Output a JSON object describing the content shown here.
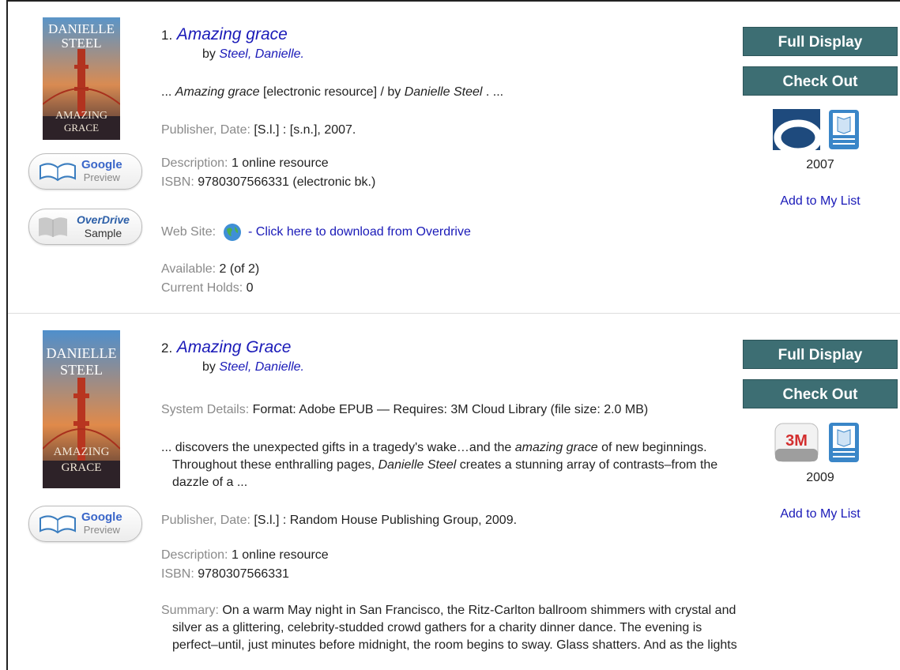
{
  "results": [
    {
      "number": "1.",
      "title": "Amazing grace",
      "by_prefix": "by",
      "author": "Steel, Danielle.",
      "snippet_pre": "... ",
      "snippet_title": "Amazing grace",
      "snippet_mid": " [electronic resource] / by ",
      "snippet_author": "Danielle Steel",
      "snippet_post": " . ...",
      "publisher_label": "Publisher, Date:",
      "publisher_value": "[S.l.] : [s.n.], 2007.",
      "description_label": "Description:",
      "description_value": "1 online resource",
      "isbn_label": "ISBN:",
      "isbn_value": "9780307566331 (electronic bk.)",
      "website_label": "Web Site:",
      "website_link": "- Click here to download from Overdrive",
      "available_label": "Available:",
      "available_value": "2 (of 2)",
      "holds_label": "Current Holds:",
      "holds_value": "0",
      "year": "2007",
      "full_display": "Full Display",
      "check_out": "Check Out",
      "add_list": "Add to My List",
      "cover_author": [
        "DANIELLE",
        "STEEL"
      ],
      "cover_title": [
        "AMAZING",
        "GRACE"
      ],
      "google_label": "Google",
      "preview_label": "Preview",
      "overdrive_label": "OverDrive",
      "sample_label": "Sample",
      "provider_icon": "overdrive-logo-icon",
      "format_icon": "ebook-icon"
    },
    {
      "number": "2.",
      "title": "Amazing Grace",
      "by_prefix": "by",
      "author": "Steel, Danielle.",
      "system_label": "System Details:",
      "system_value": "Format: Adobe EPUB — Requires: 3M Cloud Library (file size: 2.0 MB)",
      "snippet_a": "... discovers the unexpected gifts in a tragedy's wake…and the ",
      "snippet_b": "amazing grace",
      "snippet_c": " of new beginnings. Throughout these enthralling pages, ",
      "snippet_d": "Danielle Steel",
      "snippet_e": " creates a stunning array of contrasts–from the dazzle of a ...",
      "publisher_label": "Publisher, Date:",
      "publisher_value": "[S.l.] : Random House Publishing Group, 2009.",
      "description_label": "Description:",
      "description_value": "1 online resource",
      "isbn_label": "ISBN:",
      "isbn_value": "9780307566331",
      "summary_label": "Summary:",
      "summary_value": "On a warm May night in San Francisco, the Ritz-Carlton ballroom shimmers with crystal and silver as a glittering, celebrity-studded crowd gathers for a charity dinner dance. The evening is perfect–until, just minutes before midnight, the room begins to sway. Glass shatters. And as the lights",
      "year": "2009",
      "full_display": "Full Display",
      "check_out": "Check Out",
      "add_list": "Add to My List",
      "cover_author": [
        "DANIELLE",
        "STEEL"
      ],
      "cover_title": [
        "AMAZING",
        "GRACE"
      ],
      "google_label": "Google",
      "preview_label": "Preview",
      "provider_icon": "3m-cloud-library-icon",
      "provider_text": "3M",
      "format_icon": "ebook-icon"
    }
  ]
}
